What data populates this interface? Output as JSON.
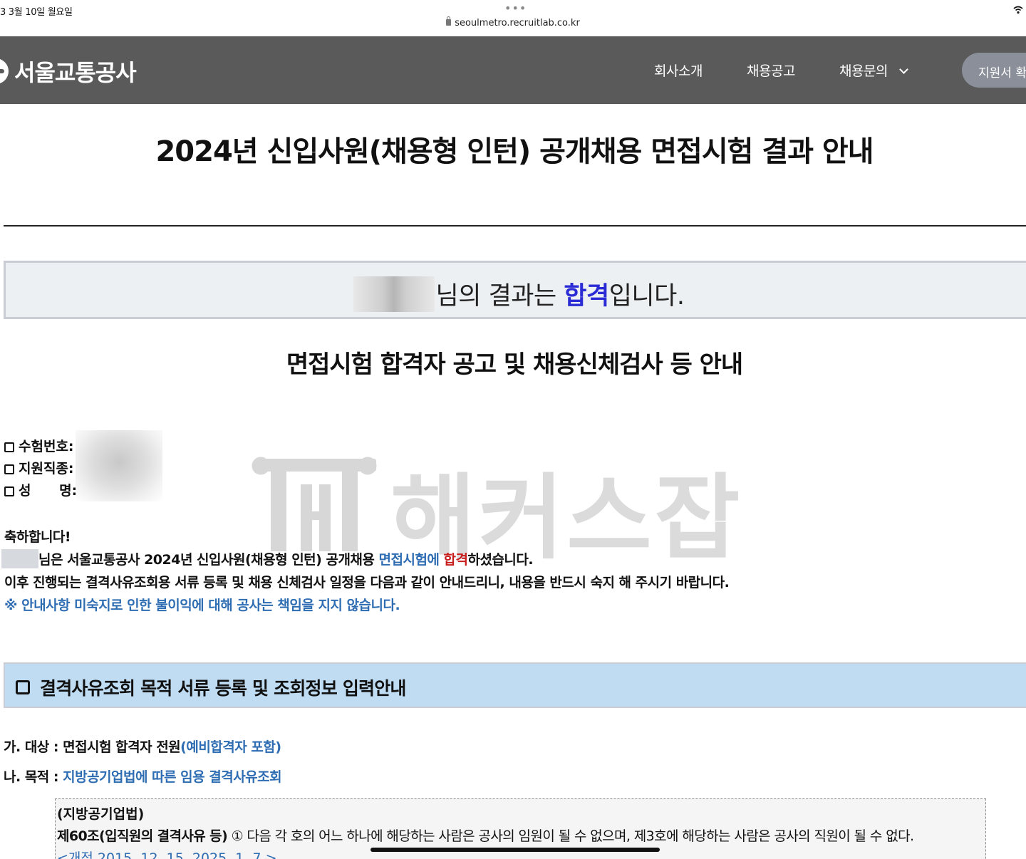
{
  "status": {
    "time": "3   3월 10일 월요일",
    "url": "seoulmetro.recruitlab.co.kr"
  },
  "nav": {
    "logo": "서울교통공사",
    "items": [
      "회사소개",
      "채용공고",
      "채용문의"
    ],
    "apply_button": "지원서 확"
  },
  "page": {
    "title": "2024년 신입사원(채용형 인턴) 공개채용 면접시험 결과 안내",
    "result_prefix": "님의 결과는 ",
    "result_word": "합격",
    "result_suffix": "입니다.",
    "subtitle": "면접시험 합격자 공고 및 채용신체검사 등 안내"
  },
  "info": {
    "exam_no": "수험번호:",
    "job": "지원직종:",
    "name": "성      명:"
  },
  "watermark": "해커스잡",
  "congrats": {
    "heading": "축하합니다!",
    "line1_a": "님은 서울교통공사 2024년 신입사원(채용형 인턴) 공개채용 ",
    "line1_b": "면접시험에 ",
    "line1_c": "합격",
    "line1_d": "하셨습니다.",
    "line2": "이후 진행되는 결격사유조회용 서류 등록 및 채용 신체검사 일정을 다음과 같이 안내드리니, 내용을 반드시 숙지 해 주시기 바랍니다.",
    "line3": "※ 안내사항 미숙지로 인한 불이익에 대해 공사는 책임을 지지 않습니다."
  },
  "section": {
    "title": "결격사유조회 목적 서류 등록 및 조회정보 입력안내",
    "a_label": "가. 대상 : 면접시험 합격자 전원",
    "a_blue": "(예비합격자 포함)",
    "b_label": "나. 목적 : ",
    "b_blue": "지방공기업법에 따른 임용 결격사유조회"
  },
  "law": {
    "line1": "(지방공기업법)",
    "line2_bold": "제60조(입직원의 결격사유 등)",
    "line2_rest": " ① 다음 각 호의 어느 하나에 해당하는 사람은 공사의 임원이 될 수 없으며, 제3호에 해당하는 사람은 공사의 직원이 될 수 없다.",
    "line3": "<개정 2015. 12. 15. 2025. 1. 7.>"
  },
  "colors": {
    "navbar": "#5a5a5a",
    "pass_blue": "#2b2bd6",
    "link_blue": "#2f6db3",
    "pass_red": "#c81e1e",
    "section_bg": "#bfdcf2"
  }
}
